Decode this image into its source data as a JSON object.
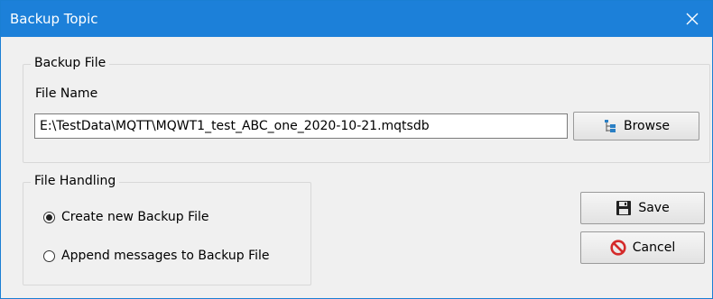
{
  "window": {
    "title": "Backup Topic"
  },
  "backup_file": {
    "group_label": "Backup File",
    "file_name_label": "File Name",
    "file_name_value": "E:\\TestData\\MQTT\\MQWT1_test_ABC_one_2020-10-21.mqtsdb",
    "browse_label": "Browse"
  },
  "file_handling": {
    "group_label": "File Handling",
    "options": [
      {
        "label": "Create new Backup File",
        "selected": true
      },
      {
        "label": "Append messages to Backup File",
        "selected": false
      }
    ]
  },
  "actions": {
    "save_label": "Save",
    "cancel_label": "Cancel"
  },
  "icons": {
    "close": "close-icon",
    "browse": "folder-tree-icon",
    "save": "floppy-disk-icon",
    "cancel": "no-entry-icon"
  },
  "colors": {
    "titlebar": "#1c80d9",
    "cancel_icon": "#d42a2a",
    "browse_icon": "#2a7fc4"
  }
}
